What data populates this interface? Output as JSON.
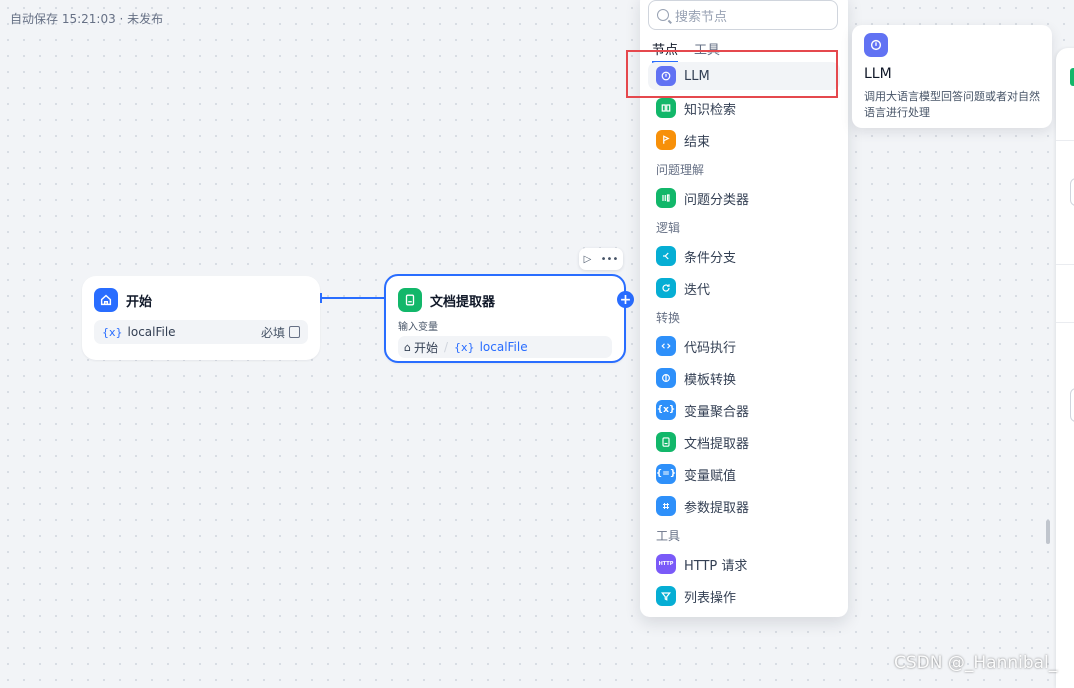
{
  "status": {
    "autosave": "自动保存 15:21:03 · 未发布"
  },
  "canvas": {
    "start_node": {
      "title": "开始",
      "variable": {
        "prefix": "{x}",
        "name": "localFile",
        "required_label": "必填"
      }
    },
    "doc_node": {
      "title": "文档提取器",
      "input_label": "输入变量",
      "source_node": "开始",
      "variable_prefix": "{x}",
      "variable": "localFile"
    },
    "node_toolbar": {
      "run_icon": "play-icon",
      "more_icon": "more-icon"
    },
    "add_handle": "+"
  },
  "selector": {
    "search_placeholder": "搜索节点",
    "tabs": [
      {
        "label": "节点",
        "active": true
      },
      {
        "label": "工具",
        "active": false
      }
    ],
    "items": [
      {
        "label": "LLM",
        "icon": "llm-icon",
        "color": "#6172f3",
        "highlighted": true
      },
      {
        "label": "知识检索",
        "icon": "book-icon",
        "color": "#12b76a"
      },
      {
        "label": "结束",
        "icon": "flag-icon",
        "color": "#f79009"
      },
      {
        "section": "问题理解"
      },
      {
        "label": "问题分类器",
        "icon": "classifier-icon",
        "color": "#12b76a"
      },
      {
        "section": "逻辑"
      },
      {
        "label": "条件分支",
        "icon": "branch-icon",
        "color": "#06aed4"
      },
      {
        "label": "迭代",
        "icon": "loop-icon",
        "color": "#06aed4"
      },
      {
        "section": "转换"
      },
      {
        "label": "代码执行",
        "icon": "code-icon",
        "color": "#2e90fa"
      },
      {
        "label": "模板转换",
        "icon": "template-icon",
        "color": "#2e90fa"
      },
      {
        "label": "变量聚合器",
        "icon": "variable-icon",
        "color": "#2e90fa"
      },
      {
        "label": "文档提取器",
        "icon": "document-icon",
        "color": "#12b76a"
      },
      {
        "label": "变量赋值",
        "icon": "assign-icon",
        "color": "#2e90fa"
      },
      {
        "label": "参数提取器",
        "icon": "grid-icon",
        "color": "#2e90fa"
      },
      {
        "section": "工具"
      },
      {
        "label": "HTTP 请求",
        "icon": "http-icon",
        "color": "#7a5af8",
        "badge": "HTTP"
      },
      {
        "label": "列表操作",
        "icon": "filter-icon",
        "color": "#06aed4"
      }
    ]
  },
  "tooltip": {
    "title": "LLM",
    "description": "调用大语言模型回答问题或者对自然语言进行处理"
  },
  "watermark": "CSDN @_Hannibal_"
}
